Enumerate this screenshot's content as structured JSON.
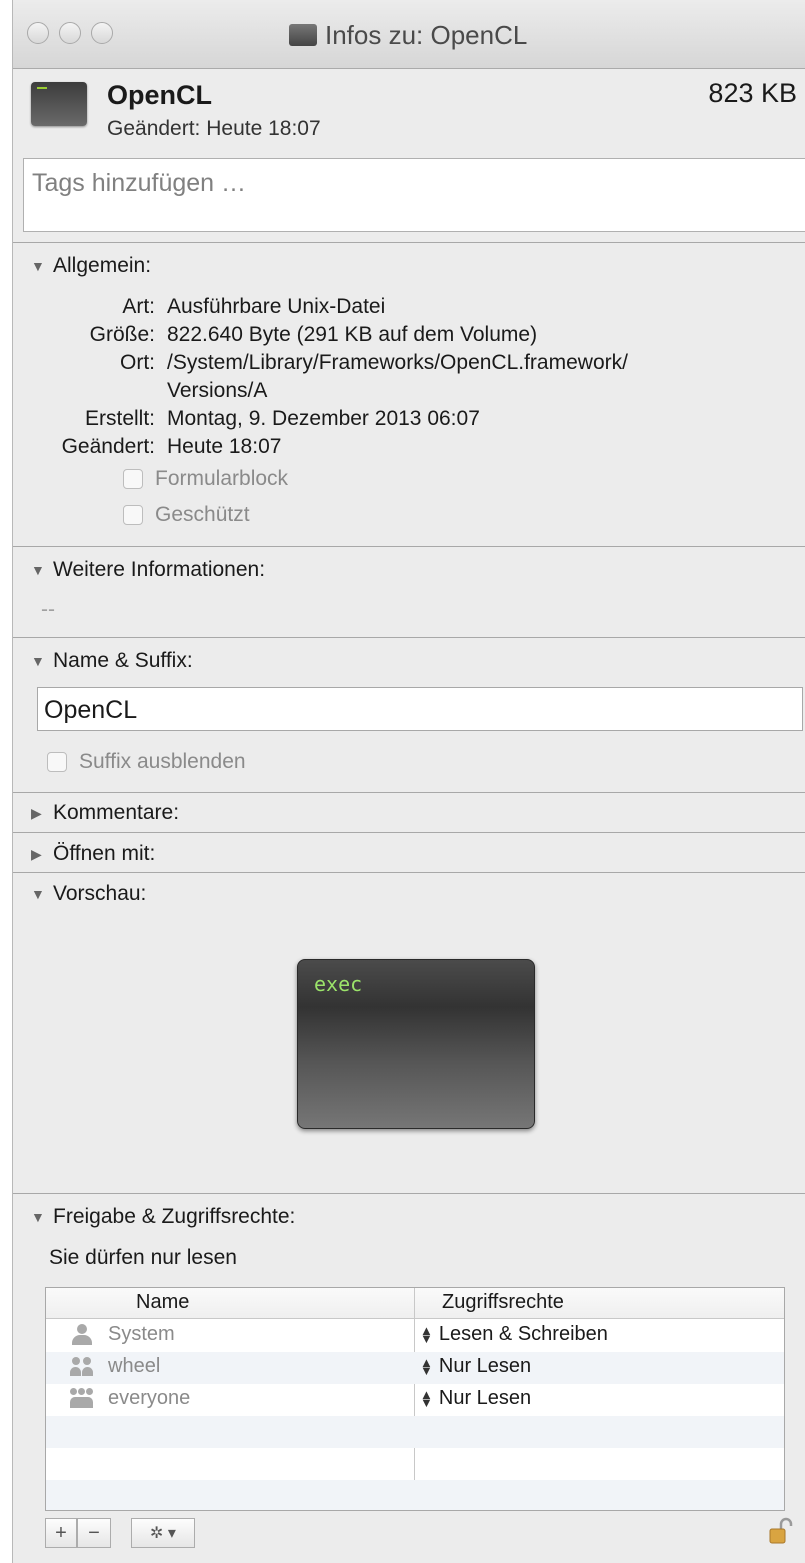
{
  "window": {
    "title": "Infos zu: OpenCL"
  },
  "header": {
    "name": "OpenCL",
    "size": "823 KB",
    "modified": "Geändert: Heute 18:07"
  },
  "tags": {
    "placeholder": "Tags hinzufügen …"
  },
  "general": {
    "heading": "Allgemein:",
    "rows": [
      {
        "label": "Art:",
        "value": "Ausführbare Unix-Datei"
      },
      {
        "label": "Größe:",
        "value": "822.640 Byte (291 KB auf dem Volume)"
      },
      {
        "label": "Ort:",
        "value": "/System/Library/Frameworks/OpenCL.framework/",
        "value2": "Versions/A"
      },
      {
        "label": "Erstellt:",
        "value": "Montag, 9. Dezember 2013 06:07"
      },
      {
        "label": "Geändert:",
        "value": "Heute 18:07"
      }
    ],
    "checkbox_formular": "Formularblock",
    "checkbox_protected": "Geschützt"
  },
  "more_info": {
    "heading": "Weitere Informationen:",
    "value": "--"
  },
  "name_suffix": {
    "heading": "Name & Suffix:",
    "value": "OpenCL",
    "hide_suffix": "Suffix ausblenden"
  },
  "comments": {
    "heading": "Kommentare:"
  },
  "open_with": {
    "heading": "Öffnen mit:"
  },
  "preview": {
    "heading": "Vorschau:",
    "text": "exec"
  },
  "sharing": {
    "heading": "Freigabe & Zugriffsrechte:",
    "status": "Sie dürfen nur lesen",
    "columns": [
      "Name",
      "Zugriffsrechte"
    ],
    "rows": [
      {
        "name": "System",
        "privilege": "Lesen & Schreiben"
      },
      {
        "name": "wheel",
        "privilege": "Nur Lesen"
      },
      {
        "name": "everyone",
        "privilege": "Nur Lesen"
      }
    ],
    "add_label": "+",
    "remove_label": "−",
    "action_label": "✲ ▾"
  }
}
